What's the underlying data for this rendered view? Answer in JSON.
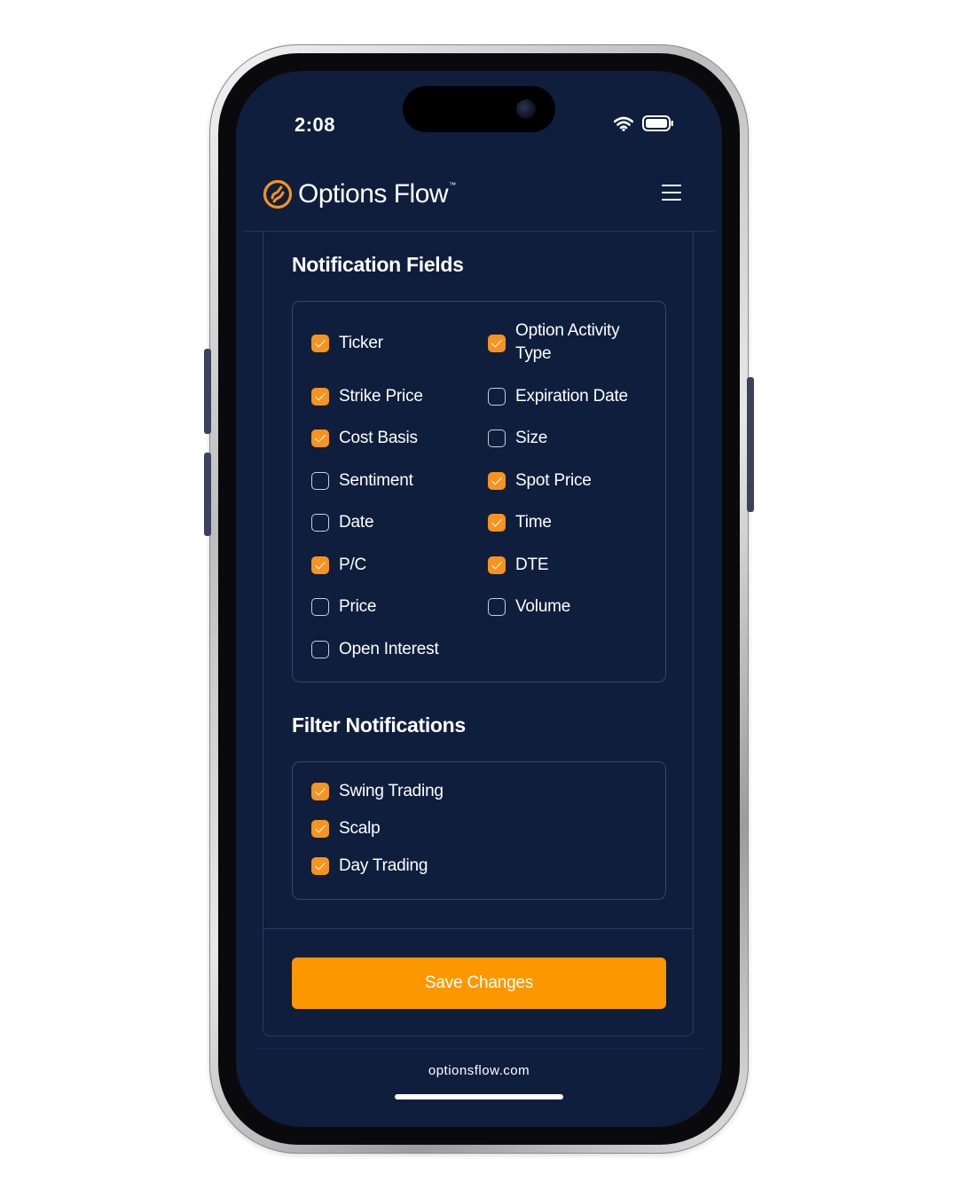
{
  "status_bar": {
    "time": "2:08"
  },
  "header": {
    "brand_name": "Options Flow",
    "trademark": "™"
  },
  "notification_fields": {
    "title": "Notification Fields",
    "left": [
      {
        "label": "Ticker",
        "checked": true
      },
      {
        "label": "Strike Price",
        "checked": true
      },
      {
        "label": "Cost Basis",
        "checked": true
      },
      {
        "label": "Sentiment",
        "checked": false
      },
      {
        "label": "Date",
        "checked": false
      },
      {
        "label": "P/C",
        "checked": true
      },
      {
        "label": "Price",
        "checked": false
      },
      {
        "label": "Open Interest",
        "checked": false
      }
    ],
    "right": [
      {
        "label": "Option Activity Type",
        "checked": true
      },
      {
        "label": "Expiration Date",
        "checked": false
      },
      {
        "label": "Size",
        "checked": false
      },
      {
        "label": "Spot Price",
        "checked": true
      },
      {
        "label": "Time",
        "checked": true
      },
      {
        "label": "DTE",
        "checked": true
      },
      {
        "label": "Volume",
        "checked": false
      }
    ]
  },
  "filter_notifications": {
    "title": "Filter Notifications",
    "items": [
      {
        "label": "Swing Trading",
        "checked": true
      },
      {
        "label": "Scalp",
        "checked": true
      },
      {
        "label": "Day Trading",
        "checked": true
      }
    ]
  },
  "save_button": {
    "label": "Save Changes"
  },
  "footer": {
    "url": "optionsflow.com"
  },
  "colors": {
    "background": "#0f1e3d",
    "accent": "#fd9700",
    "checkbox_checked": "#f7931e",
    "border": "#34456b"
  }
}
